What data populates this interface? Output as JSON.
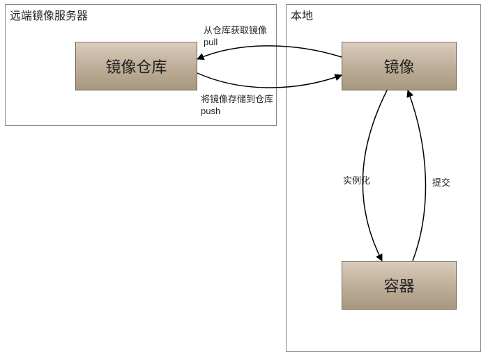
{
  "remote": {
    "title": "远端镜像服务器",
    "repository_label": "镜像仓库"
  },
  "local": {
    "title": "本地",
    "image_label": "镜像",
    "container_label": "容器"
  },
  "edges": {
    "pull": {
      "line1": "从仓库获取镜像",
      "line2": "pull"
    },
    "push": {
      "line1": "将镜像存储到仓库",
      "line2": "push"
    },
    "instantiate": "实例化",
    "commit": "提交"
  }
}
